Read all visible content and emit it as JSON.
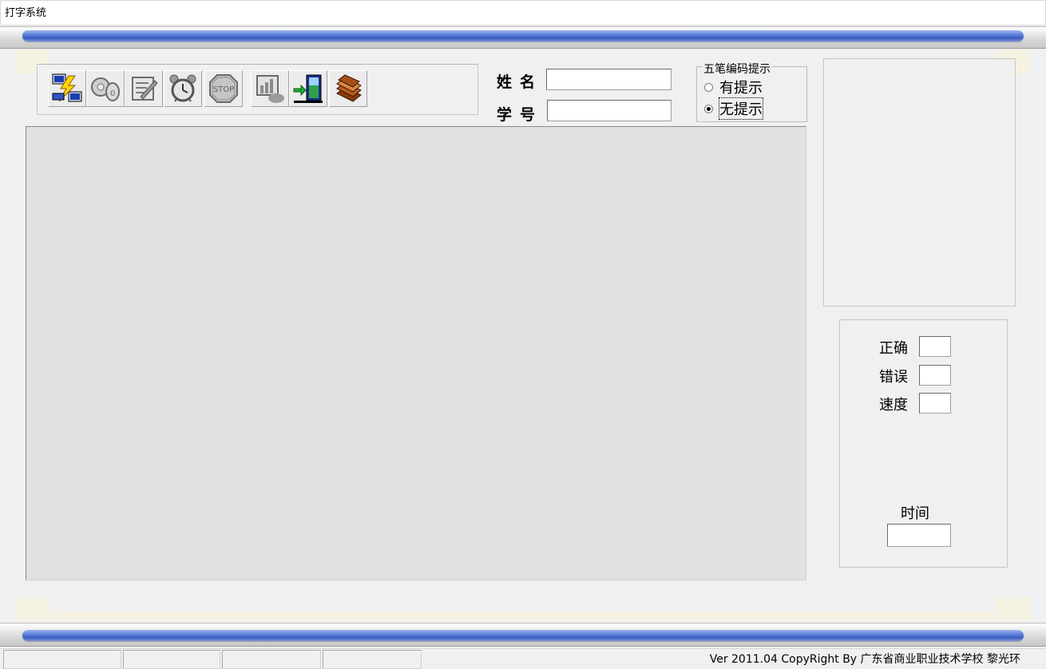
{
  "window": {
    "title": "打字系统"
  },
  "toolbar": {
    "buttons": [
      {
        "name": "network",
        "icon": "network-computers-icon",
        "enabled": true
      },
      {
        "name": "key",
        "icon": "key-icon",
        "enabled": false
      },
      {
        "name": "edit",
        "icon": "edit-document-icon",
        "enabled": false
      },
      {
        "name": "timer",
        "icon": "alarm-clock-icon",
        "enabled": false
      },
      {
        "name": "stop",
        "icon": "stop-sign-icon",
        "enabled": false,
        "text": "STOP"
      },
      {
        "name": "report",
        "icon": "report-chart-icon",
        "enabled": false
      },
      {
        "name": "exit",
        "icon": "exit-door-icon",
        "enabled": true
      },
      {
        "name": "books",
        "icon": "books-icon",
        "enabled": true
      }
    ]
  },
  "student": {
    "name_label": "姓名",
    "name_value": "",
    "id_label": "学号",
    "id_value": ""
  },
  "hint": {
    "legend": "五笔编码提示",
    "option_on": "有提示",
    "option_off": "无提示",
    "selected": "无提示"
  },
  "stats": {
    "correct_label": "正确",
    "correct_value": "",
    "error_label": "错误",
    "error_value": "",
    "speed_label": "速度",
    "speed_value": "",
    "time_label": "时间",
    "time_value": ""
  },
  "statusbar": {
    "panels": [
      "",
      "",
      "",
      ""
    ],
    "copyright": "Ver 2011.04 CopyRight By 广东省商业职业技术学校 黎光环"
  },
  "colors": {
    "rod_blue": "#4a6ccc",
    "text_area_bg": "#e1e1e1",
    "window_bg": "#f0f0f0",
    "paper": "#f5f2e2"
  }
}
